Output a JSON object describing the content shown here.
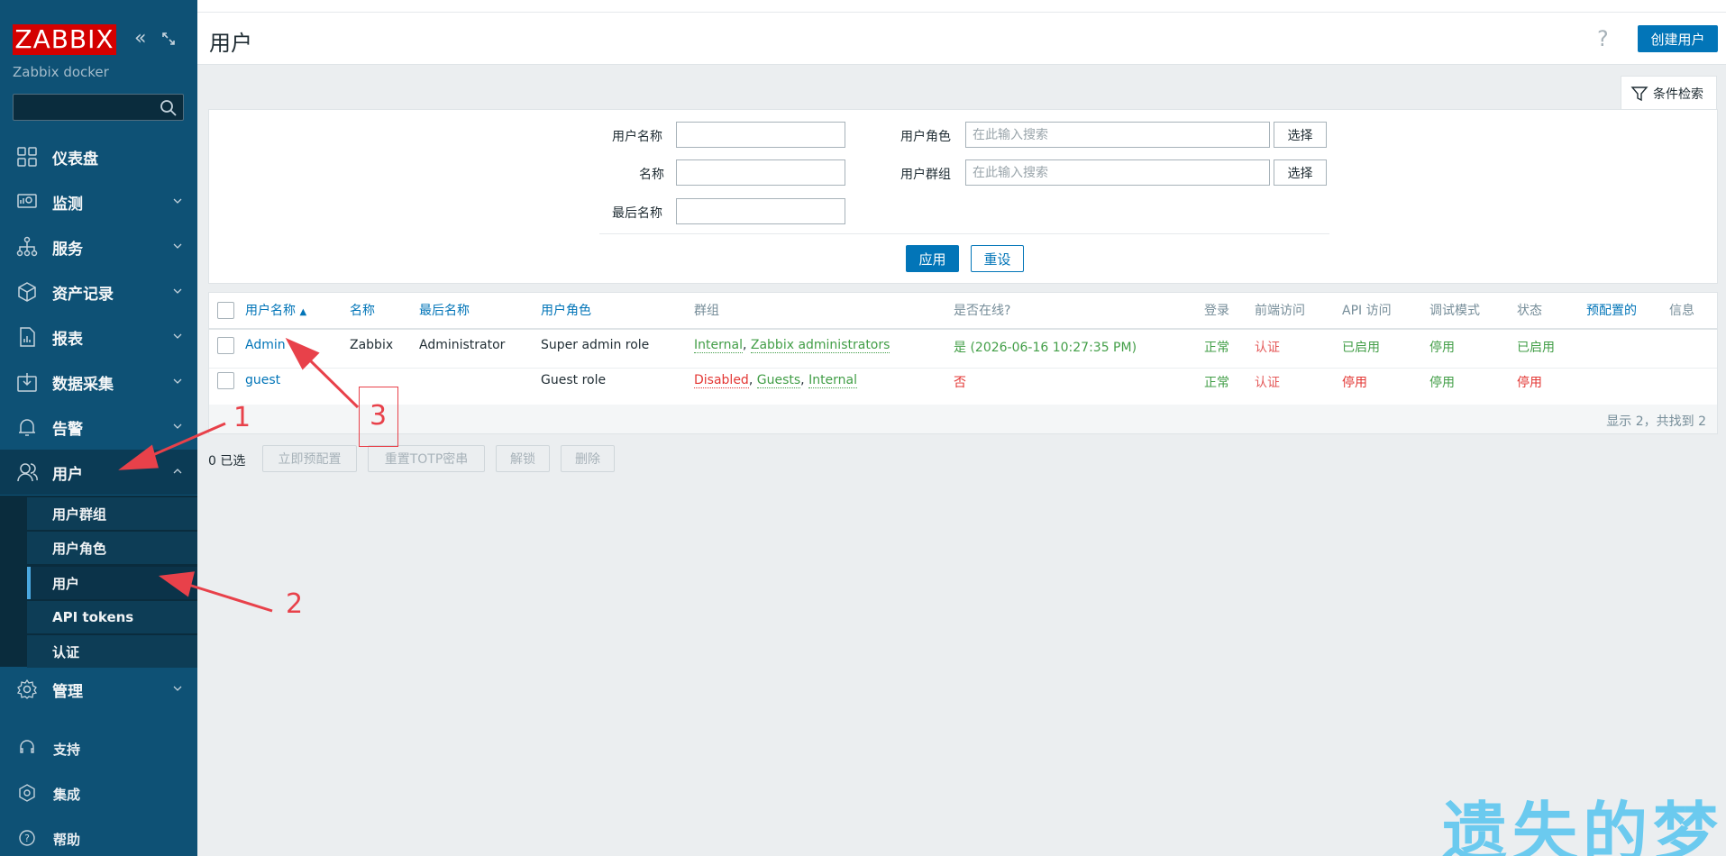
{
  "sidebar": {
    "logo": "ZABBIX",
    "server_name": "Zabbix docker",
    "menu": [
      {
        "label": "仪表盘",
        "icon": "dashboard-icon"
      },
      {
        "label": "监测",
        "icon": "monitoring-icon"
      },
      {
        "label": "服务",
        "icon": "services-icon"
      },
      {
        "label": "资产记录",
        "icon": "inventory-icon"
      },
      {
        "label": "报表",
        "icon": "reports-icon"
      },
      {
        "label": "数据采集",
        "icon": "data-collection-icon"
      },
      {
        "label": "告警",
        "icon": "alerts-icon"
      },
      {
        "label": "用户",
        "icon": "users-icon"
      },
      {
        "label": "管理",
        "icon": "administration-icon"
      }
    ],
    "submenu": [
      "用户群组",
      "用户角色",
      "用户",
      "API tokens",
      "认证"
    ],
    "bottom": [
      {
        "label": "支持",
        "icon": "support-icon"
      },
      {
        "label": "集成",
        "icon": "integrations-icon"
      },
      {
        "label": "帮助",
        "icon": "help-icon"
      }
    ]
  },
  "header": {
    "title": "用户",
    "help": "?",
    "create_button": "创建用户"
  },
  "filter": {
    "tab_label": "条件检索",
    "username_label": "用户名称",
    "name_label": "名称",
    "surname_label": "最后名称",
    "role_label": "用户角色",
    "group_label": "用户群组",
    "search_placeholder": "在此输入搜索",
    "select_button": "选择",
    "apply_button": "应用",
    "reset_button": "重设"
  },
  "table": {
    "headers": {
      "username": "用户名称",
      "sort_indicator": "▲",
      "name": "名称",
      "surname": "最后名称",
      "role": "用户角色",
      "groups": "群组",
      "online": "是否在线?",
      "login": "登录",
      "frontend": "前端访问",
      "api": "API 访问",
      "debug": "调试模式",
      "status": "状态",
      "provisioned": "预配置的",
      "info": "信息"
    },
    "rows": [
      {
        "username": "Admin",
        "name": "Zabbix",
        "surname": "Administrator",
        "role": "Super admin role",
        "group1": "Internal",
        "sep": ", ",
        "group2": "Zabbix administrators",
        "online": "是 (2026-06-16 10:27:35 PM)",
        "login": "正常",
        "frontend": "认证",
        "api": "已启用",
        "debug": "停用",
        "status": "已启用"
      },
      {
        "username": "guest",
        "name": "",
        "surname": "",
        "role": "Guest role",
        "group1": "Disabled",
        "sep": ", ",
        "group2": "Guests",
        "sep2": ", ",
        "group3": "Internal",
        "online": "否",
        "login": "正常",
        "frontend": "认证",
        "api": "停用",
        "debug": "停用",
        "status": "停用"
      }
    ],
    "footer": "显示 2，共找到 2"
  },
  "mass_actions": {
    "selected": "0 已选",
    "provision": "立即预配置",
    "reset_totp": "重置TOTP密串",
    "unblock": "解锁",
    "delete": "删除"
  },
  "annotations": {
    "a1": "1",
    "a2": "2",
    "a3": "3"
  },
  "watermark": "遗失的梦",
  "colors": {
    "sidebar": "#0e5175",
    "accent": "#0275b8",
    "logo": "#d40000",
    "annotation": "#e8414a"
  }
}
